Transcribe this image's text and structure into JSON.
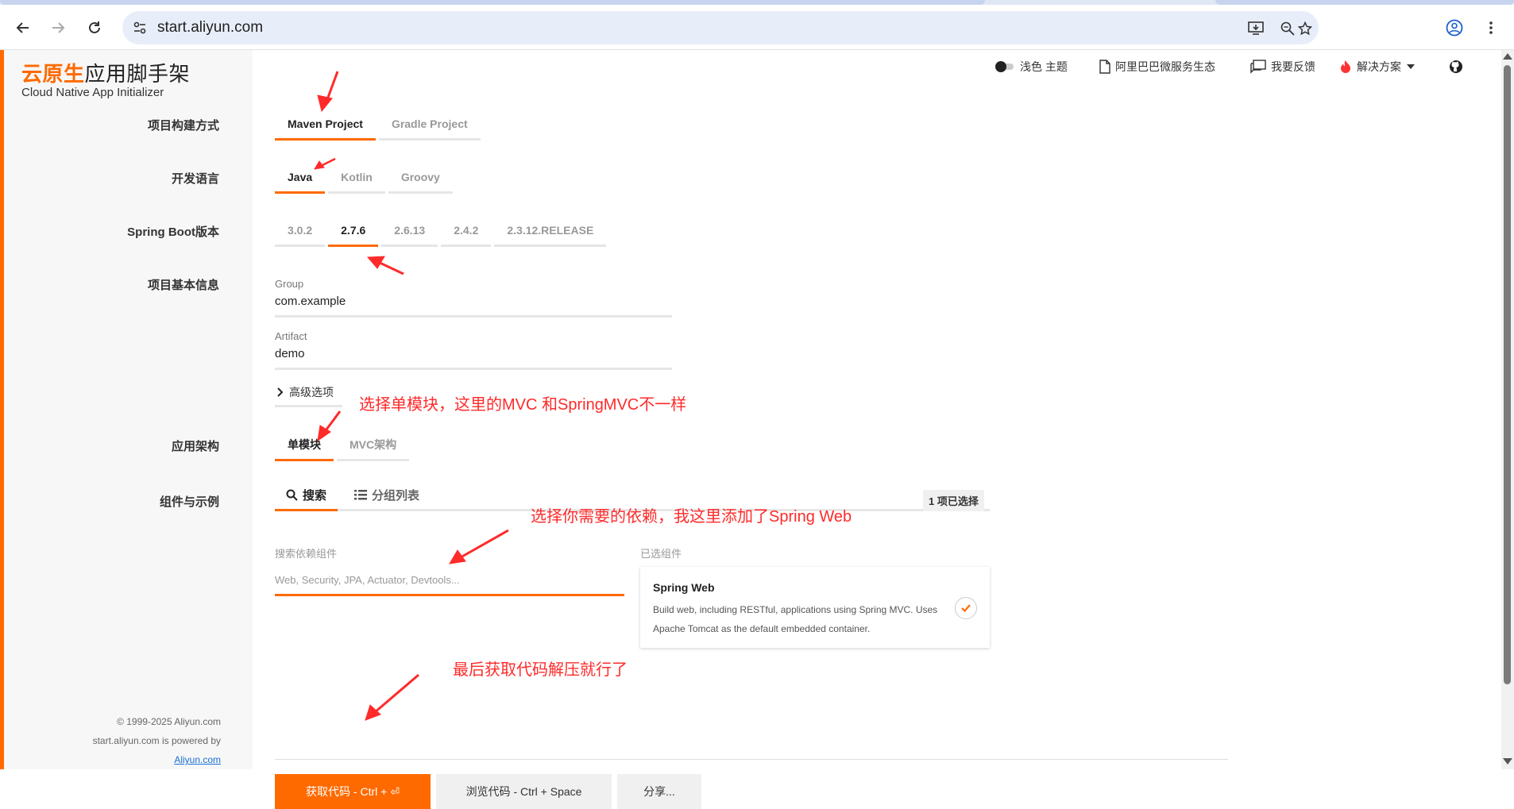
{
  "browser": {
    "url": "start.aliyun.com"
  },
  "logo": {
    "title_highlight": "云原生",
    "title_rest": "应用脚手架",
    "subtitle": "Cloud Native App Initializer"
  },
  "header_links": {
    "theme": "浅色 主题",
    "ecosystem": "阿里巴巴微服务生态",
    "feedback": "我要反馈",
    "solutions": "解决方案"
  },
  "labels": {
    "build": "项目构建方式",
    "language": "开发语言",
    "boot": "Spring Boot版本",
    "info": "项目基本信息",
    "arch": "应用架构",
    "components": "组件与示例"
  },
  "build_tabs": [
    "Maven Project",
    "Gradle Project"
  ],
  "language_tabs": [
    "Java",
    "Kotlin",
    "Groovy"
  ],
  "boot_tabs": [
    "3.0.2",
    "2.7.6",
    "2.6.13",
    "2.4.2",
    "2.3.12.RELEASE"
  ],
  "fields": {
    "group_label": "Group",
    "group_value": "com.example",
    "artifact_label": "Artifact",
    "artifact_value": "demo"
  },
  "advanced": "高级选项",
  "arch_tabs": [
    "单模块",
    "MVC架构"
  ],
  "dep_tabs": {
    "search": "搜索",
    "grouped": "分组列表"
  },
  "selected_count": "1 项已选择",
  "search": {
    "label": "搜索依赖组件",
    "placeholder": "Web, Security, JPA, Actuator, Devtools..."
  },
  "chosen": {
    "label": "已选组件",
    "name": "Spring Web",
    "description": "Build web, including RESTful, applications using Spring MVC. Uses Apache Tomcat as the default embedded container."
  },
  "buttons": {
    "get_code": "获取代码 - Ctrl + ⏎",
    "browse_code": "浏览代码 - Ctrl + Space",
    "share": "分享..."
  },
  "footer": {
    "copyright": "© 1999-2025 Aliyun.com",
    "powered": "start.aliyun.com is powered by",
    "link": "Aliyun.com"
  },
  "annotations": {
    "module": "选择单模块，这里的MVC 和SpringMVC不一样",
    "deps": "选择你需要的依赖，我这里添加了Spring Web",
    "final": "最后获取代码解压就行了"
  },
  "colors": {
    "accent": "#ff6a00",
    "annotation": "#ff2a2a"
  }
}
